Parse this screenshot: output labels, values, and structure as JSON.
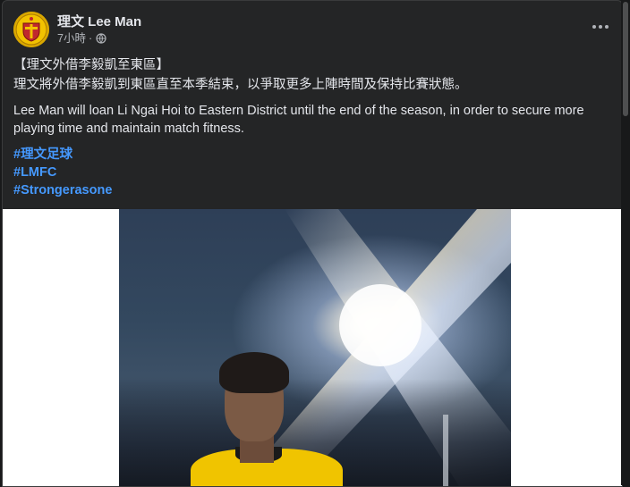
{
  "post": {
    "page_name": "理文 Lee Man",
    "time": "7小時",
    "separator": "·",
    "title_line": "【理文外借李毅凱至東區】",
    "chinese_line": "理文將外借李毅凱到東區直至本季結束，以爭取更多上陣時間及保持比賽狀態。",
    "english_line": "Lee Man will loan Li Ngai Hoi to Eastern District until the end of the season, in order to secure more playing time and maintain match fitness.",
    "hashtags": [
      "#理文足球",
      "#LMFC",
      "#Strongerasone"
    ]
  },
  "icons": {
    "avatar": "lee-man-club-crest",
    "privacy": "globe-icon",
    "menu": "more-options-icon"
  },
  "colors": {
    "card_bg": "#242526",
    "text": "#e4e6eb",
    "secondary_text": "#b0b3b8",
    "hashtag": "#4599ff",
    "crest_yellow": "#f2c200"
  }
}
